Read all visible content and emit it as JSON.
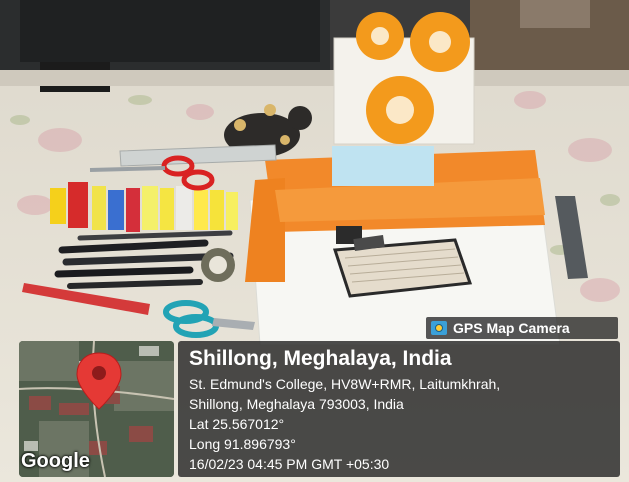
{
  "photo": {
    "description_icon": "gps-photo-scene"
  },
  "overlay": {
    "app_label": "GPS Map Camera",
    "app_icon": "camera-icon",
    "title": "Shillong, Meghalaya, India",
    "address_line1": "St. Edmund's College, HV8W+RMR, Laitumkhrah,",
    "address_line2": "Shillong, Meghalaya 793003, India",
    "latitude": "Lat 25.567012°",
    "longitude": "Long 91.896793°",
    "datetime": "16/02/23 04:45 PM GMT +05:30"
  },
  "map": {
    "provider": "Google",
    "pin_color": "#e53935",
    "pin_icon": "map-pin-icon"
  }
}
